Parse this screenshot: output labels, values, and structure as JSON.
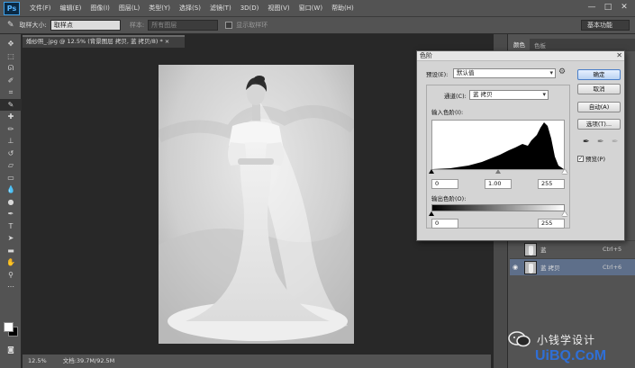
{
  "app": {
    "logo": "Ps"
  },
  "menu": [
    "文件(F)",
    "编辑(E)",
    "图像(I)",
    "图层(L)",
    "类型(Y)",
    "选择(S)",
    "滤镜(T)",
    "3D(D)",
    "视图(V)",
    "窗口(W)",
    "帮助(H)"
  ],
  "window_controls": [
    "—",
    "□",
    "✕"
  ],
  "options": {
    "sample_size_label": "取样大小:",
    "sample_size_value": "取样点",
    "sample_label": "样本:",
    "sample_value": "所有图层",
    "show_ring_label": "显示取样环",
    "workspace": "基本功能"
  },
  "document": {
    "tab_title": "婚纱照_.jpg @ 12.5% (背景图层 拷贝, 蓝 拷贝/8) * ×",
    "zoom": "12.5%",
    "doc_info": "文档:39.7M/92.5M"
  },
  "panels": {
    "tabs": [
      "颜色",
      "色板"
    ]
  },
  "layers": [
    {
      "name": "蓝",
      "shortcut": "Ctrl+5",
      "selected": false,
      "visible": false
    },
    {
      "name": "蓝 拷贝",
      "shortcut": "Ctrl+6",
      "selected": true,
      "visible": true
    }
  ],
  "levels_dialog": {
    "title": "色阶",
    "preset_label": "预设(E):",
    "preset_value": "默认值",
    "channel_label": "通道(C):",
    "channel_value": "蓝 拷贝",
    "input_levels_label": "输入色阶(I):",
    "input_black": "0",
    "input_gamma": "1.00",
    "input_white": "255",
    "output_levels_label": "输出色阶(O):",
    "output_black": "0",
    "output_white": "255",
    "ok": "确定",
    "cancel": "取消",
    "auto": "自动(A)",
    "options": "选项(T)...",
    "preview_label": "预览(P)",
    "preview_checked": true,
    "close": "✕"
  },
  "watermark": {
    "text": "小钱学设计",
    "url": "UiBQ.CoM"
  }
}
